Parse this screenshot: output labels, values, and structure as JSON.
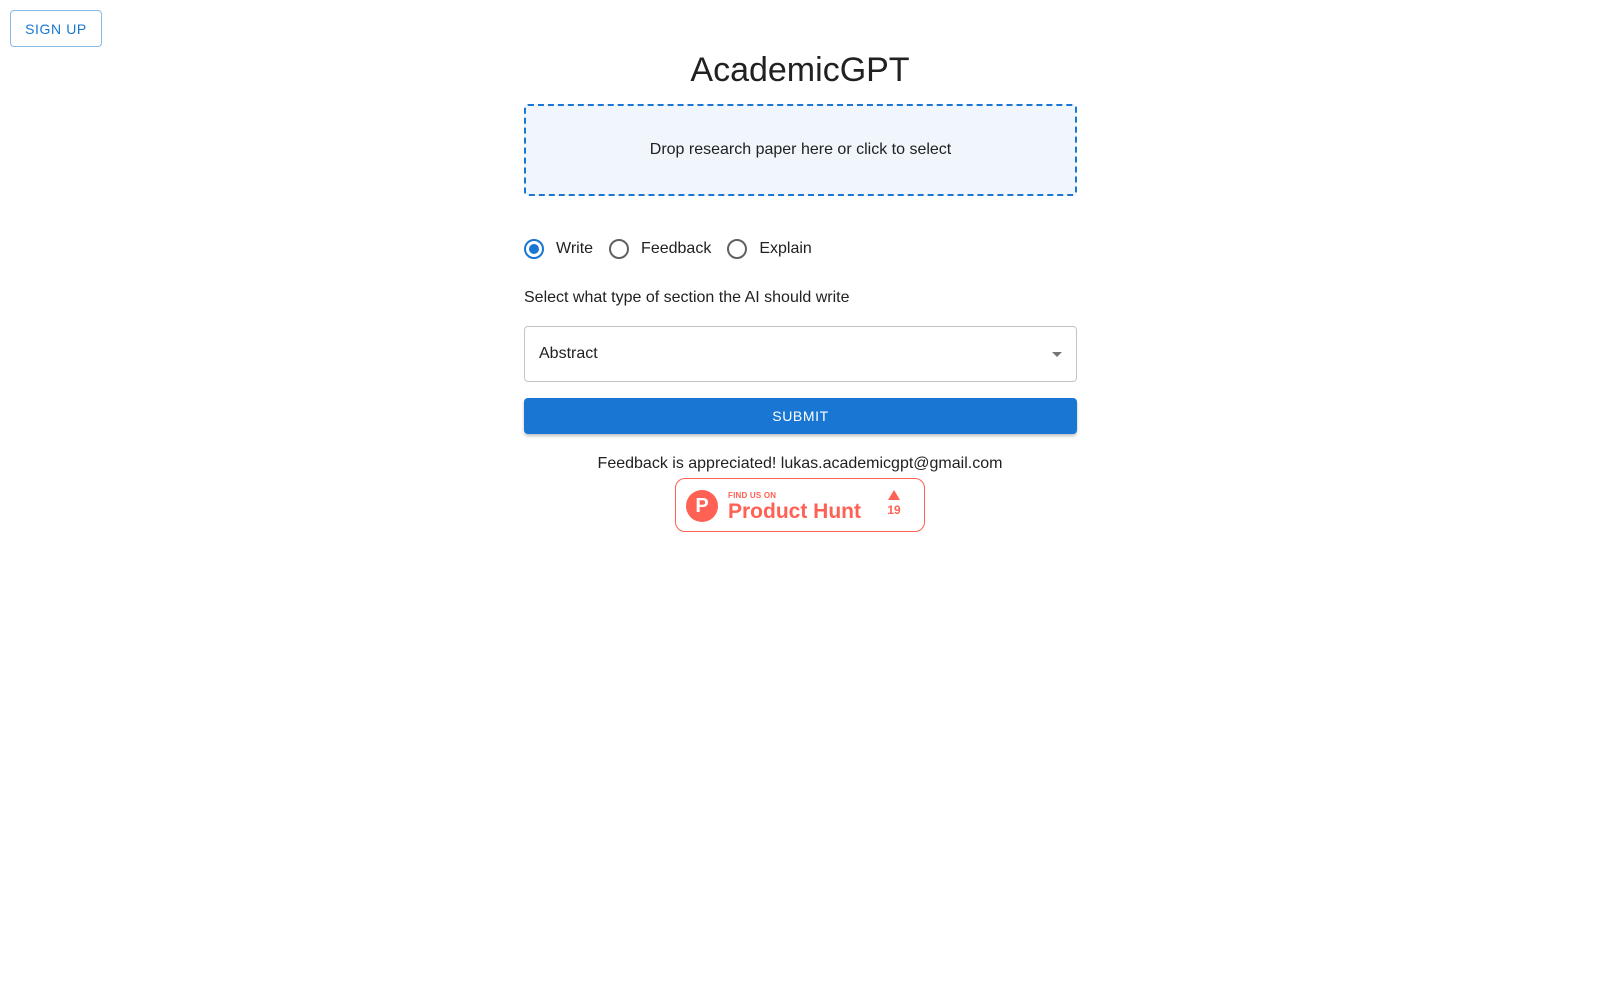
{
  "header": {
    "signup_label": "SIGN UP"
  },
  "main": {
    "title": "AcademicGPT",
    "dropzone_text": "Drop research paper here or click to select",
    "modes": [
      {
        "label": "Write",
        "checked": true
      },
      {
        "label": "Feedback",
        "checked": false
      },
      {
        "label": "Explain",
        "checked": false
      }
    ],
    "section_label": "Select what type of section the AI should write",
    "section_select": {
      "selected": "Abstract"
    },
    "submit_label": "SUBMIT",
    "feedback_text": "Feedback is appreciated! lukas.academicgpt@gmail.com"
  },
  "product_hunt": {
    "logo_letter": "P",
    "tagline": "FIND US ON",
    "name": "Product Hunt",
    "upvotes": "19"
  },
  "colors": {
    "primary": "#1976d2",
    "product_hunt": "#ff6154",
    "dropzone_bg": "#f1f6fc"
  }
}
